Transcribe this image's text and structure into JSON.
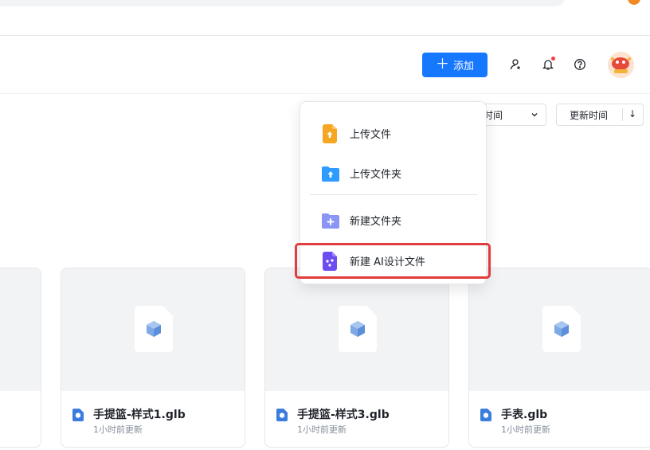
{
  "header": {
    "add_label": "添加",
    "icons": [
      "add-member-icon",
      "bell-icon",
      "help-icon"
    ]
  },
  "sort": {
    "field_label": "时间",
    "order_label": "更新时间"
  },
  "menu": {
    "items": [
      {
        "label": "上传文件",
        "icon": "upload-file-icon"
      },
      {
        "label": "上传文件夹",
        "icon": "upload-folder-icon"
      },
      {
        "label": "新建文件夹",
        "icon": "new-folder-icon"
      },
      {
        "label": "新建 AI设计文件",
        "icon": "ai-design-file-icon"
      }
    ]
  },
  "files": [
    {
      "name": "手提篮-样式1.glb",
      "time": "1小时前更新"
    },
    {
      "name": "手提篮-样式3.glb",
      "time": "1小时前更新"
    },
    {
      "name": "手表.glb",
      "time": "1小时前更新"
    }
  ],
  "colors": {
    "accent": "#1677ff",
    "highlight": "#e13b3b",
    "upload_orange": "#f5a623",
    "folder_blue": "#2f9bff",
    "new_folder": "#8b95f5",
    "ai_purple": "#6d4df2"
  }
}
